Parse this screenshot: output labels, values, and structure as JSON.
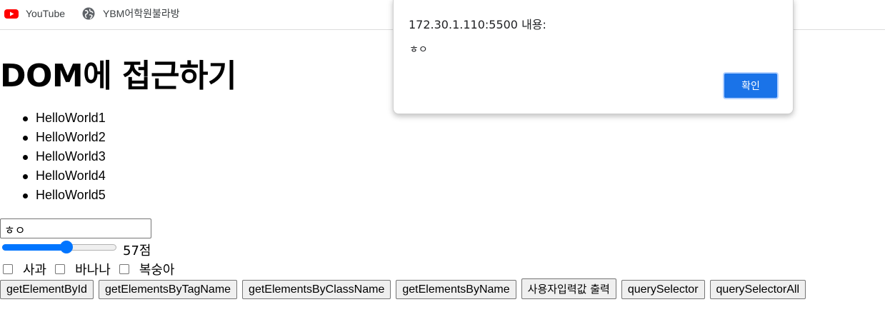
{
  "bookmarks": [
    {
      "label": "YouTube",
      "icon": "youtube-icon",
      "color": "#ff0000"
    },
    {
      "label": "YBM어학원불라방",
      "icon": "globe-icon",
      "color": "#5f6368"
    }
  ],
  "page": {
    "title": "DOM에 접근하기",
    "list_items": [
      "HelloWorld1",
      "HelloWorld2",
      "HelloWorld3",
      "HelloWorld4",
      "HelloWorld5"
    ],
    "text_input_value": "ㅎㅇ",
    "slider": {
      "value": 57,
      "min": 0,
      "max": 100,
      "accent": "#0075ff"
    },
    "score_text": "57점",
    "checkboxes": [
      {
        "label": "사과",
        "checked": false
      },
      {
        "label": "바나나",
        "checked": false
      },
      {
        "label": "복숭아",
        "checked": false
      }
    ],
    "buttons": [
      "getElementById",
      "getElementsByTagName",
      "getElementsByClassName",
      "getElementsByName",
      "사용자입력값 출력",
      "querySelector",
      "querySelectorAll"
    ]
  },
  "dialog": {
    "title": "172.30.1.110:5500 내용:",
    "message": "ㅎㅇ",
    "ok_label": "확인",
    "accent": "#1a73e8"
  }
}
